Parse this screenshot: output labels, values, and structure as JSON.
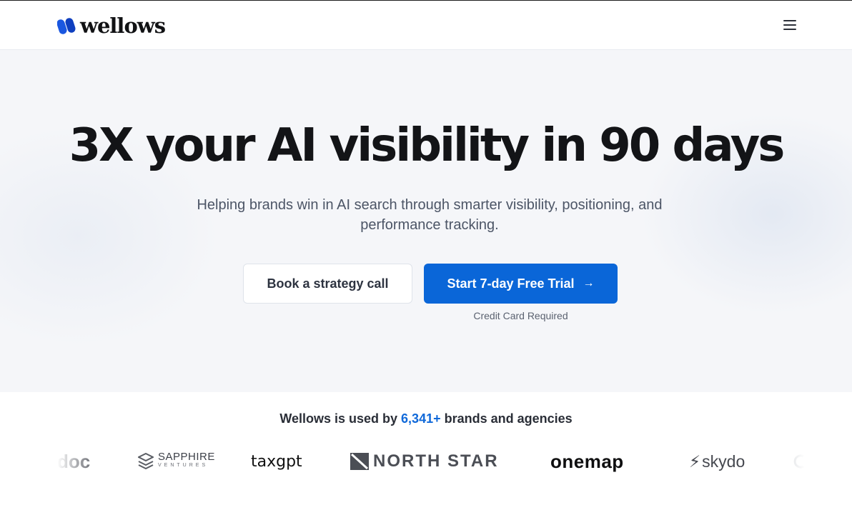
{
  "header": {
    "brand": "wellows",
    "menu_icon": "hamburger-icon"
  },
  "hero": {
    "headline": "3X your AI visibility in 90 days",
    "subheadline": "Helping brands win in AI search through smarter visibility, positioning, and performance tracking.",
    "secondary_cta": "Book a strategy call",
    "primary_cta": "Start 7-day Free Trial",
    "primary_cta_icon": "arrow-right-icon",
    "primary_cta_note": "Credit Card Required"
  },
  "trust": {
    "prefix": "Wellows is used by",
    "count": "6,341+",
    "suffix": "brands and agencies",
    "logos": [
      {
        "name": "doc",
        "text": "doc"
      },
      {
        "name": "sapphire",
        "text": "SAPPHIRE",
        "subtext": "VENTURES"
      },
      {
        "name": "taxgpt",
        "text": "taxgpt"
      },
      {
        "name": "north-star",
        "text": "NORTH STAR"
      },
      {
        "name": "onemap",
        "text": "onemap"
      },
      {
        "name": "skydo",
        "text": "skydo"
      }
    ]
  },
  "colors": {
    "accent": "#0a66d8",
    "count_color": "#1069d9",
    "hero_bg": "#f5f6f9",
    "headline": "#131417"
  }
}
